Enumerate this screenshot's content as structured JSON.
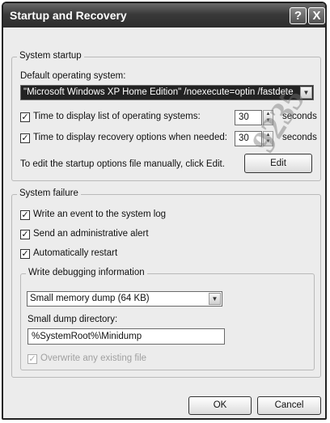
{
  "window": {
    "title": "Startup and Recovery",
    "help_glyph": "?",
    "close_glyph": "X"
  },
  "system_startup": {
    "group_label": "System startup",
    "default_os_label": "Default operating system:",
    "default_os_value": "\"Microsoft Windows XP Home Edition\" /noexecute=optin /fastdete",
    "time_list": {
      "checked": true,
      "label": "Time to display list of operating systems:",
      "value": "30",
      "unit": "seconds"
    },
    "time_recovery": {
      "checked": true,
      "label": "Time to display recovery options when needed:",
      "value": "30",
      "unit": "seconds"
    },
    "edit_text": "To edit the startup options file manually, click Edit.",
    "edit_button": "Edit"
  },
  "system_failure": {
    "group_label": "System failure",
    "write_event": {
      "checked": true,
      "label": "Write an event to the system log"
    },
    "send_alert": {
      "checked": true,
      "label": "Send an administrative alert"
    },
    "auto_restart": {
      "checked": true,
      "label": "Automatically restart"
    },
    "debug": {
      "group_label": "Write debugging information",
      "dump_type": "Small memory dump (64 KB)",
      "dump_dir_label": "Small dump directory:",
      "dump_dir_value": "%SystemRoot%\\Minidump",
      "overwrite": {
        "checked": true,
        "enabled": false,
        "label": "Overwrite any existing file"
      }
    }
  },
  "buttons": {
    "ok": "OK",
    "cancel": "Cancel"
  },
  "watermark": "9235"
}
